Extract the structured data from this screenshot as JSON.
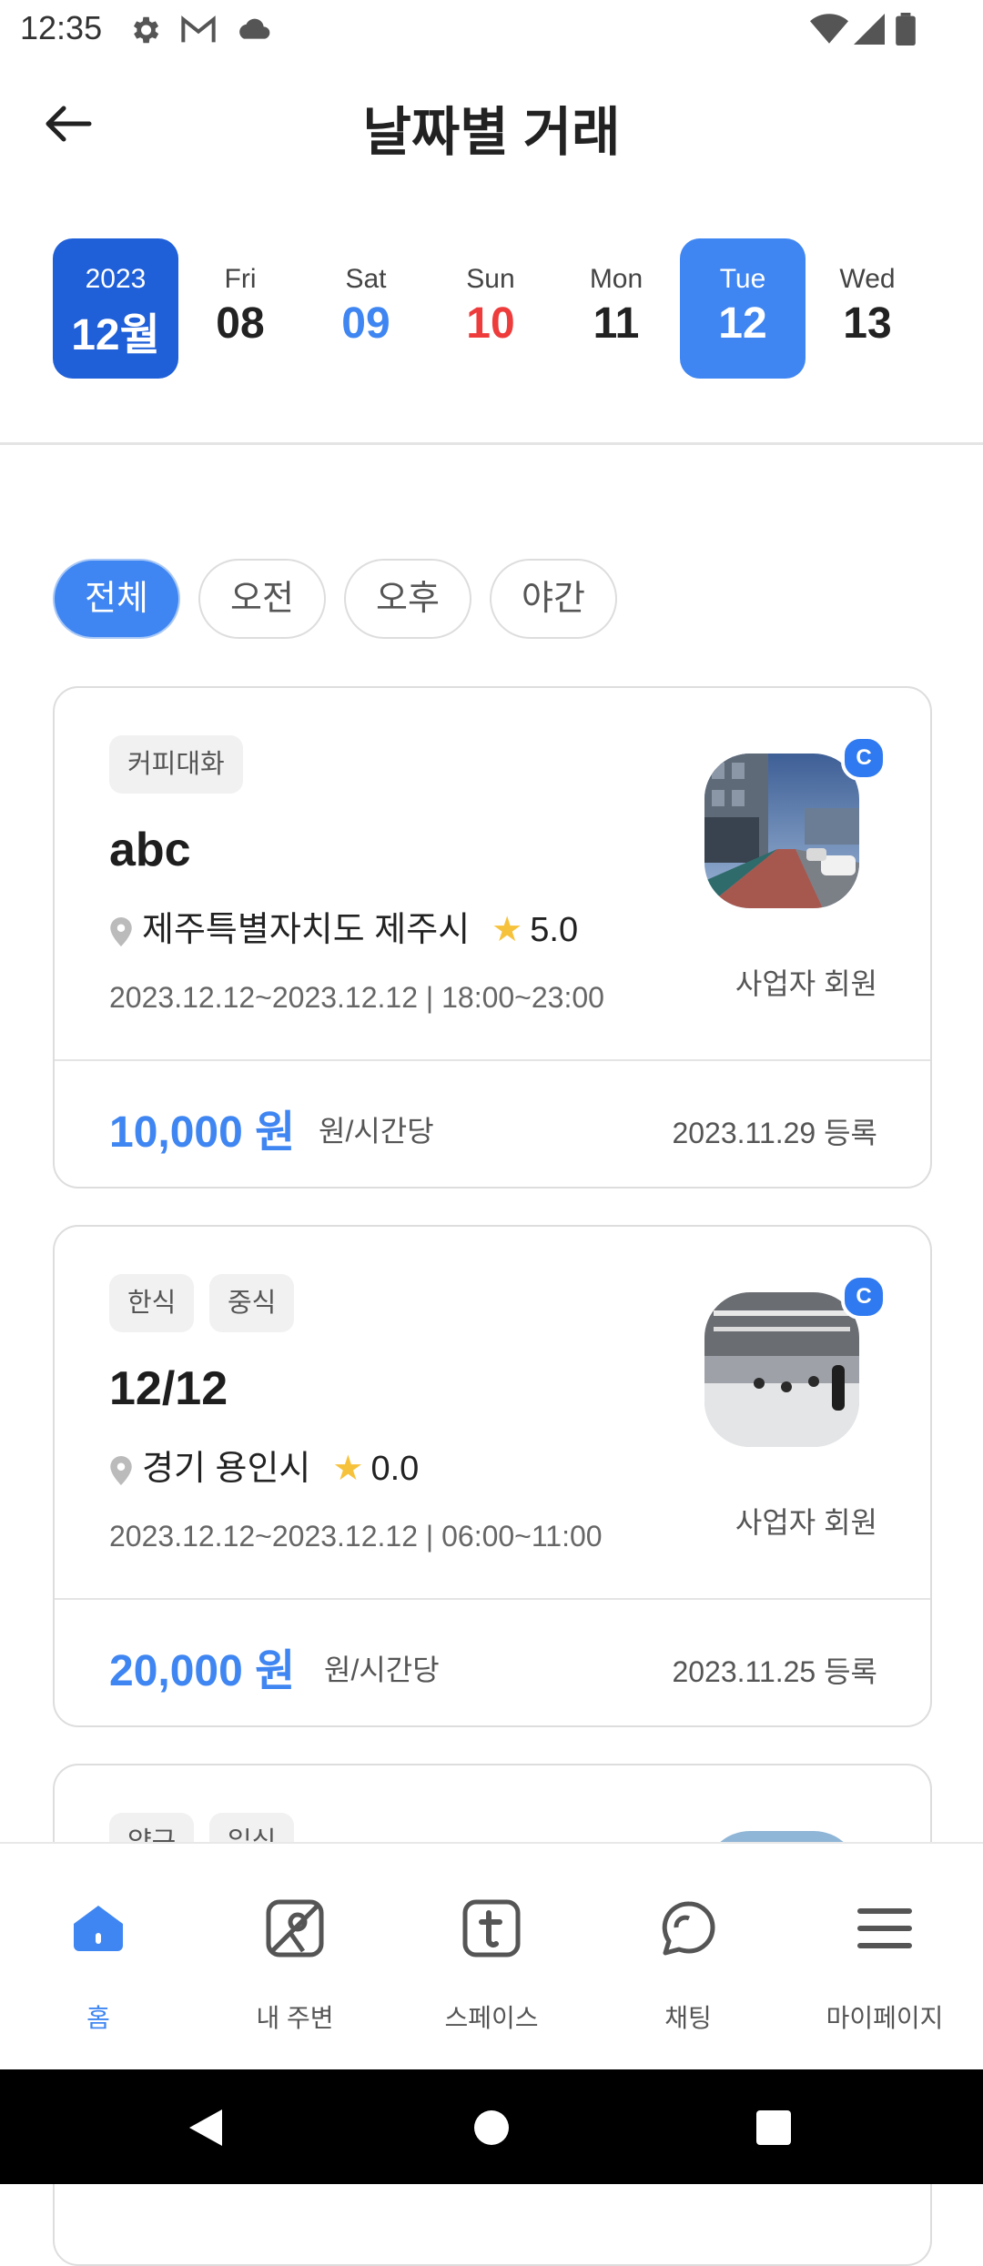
{
  "status": {
    "time": "12:35"
  },
  "header": {
    "title": "날짜별 거래"
  },
  "date_strip": {
    "month": {
      "year": "2023",
      "month": "12월"
    },
    "days": [
      {
        "dow": "Fri",
        "day": "08"
      },
      {
        "dow": "Sat",
        "day": "09"
      },
      {
        "dow": "Sun",
        "day": "10"
      },
      {
        "dow": "Mon",
        "day": "11"
      },
      {
        "dow": "Tue",
        "day": "12"
      },
      {
        "dow": "Wed",
        "day": "13"
      }
    ]
  },
  "filters": [
    "전체",
    "오전",
    "오후",
    "야간"
  ],
  "cards": [
    {
      "tags": [
        "커피대화"
      ],
      "title": "abc",
      "location": "제주특별자치도 제주시",
      "rating": "5.0",
      "period": "2023.12.12~2023.12.12 | 18:00~23:00",
      "badge": "C",
      "member": "사업자 회원",
      "price": "10,000 원",
      "unit": "원/시간당",
      "registered": "2023.11.29 등록"
    },
    {
      "tags": [
        "한식",
        "중식"
      ],
      "title": "12/12",
      "location": "경기 용인시",
      "rating": "0.0",
      "period": "2023.12.12~2023.12.12 | 06:00~11:00",
      "badge": "C",
      "member": "사업자 회원",
      "price": "20,000 원",
      "unit": "원/시간당",
      "registered": "2023.11.25 등록"
    },
    {
      "tags": [
        "양구",
        "일식"
      ]
    }
  ],
  "bottom_nav": [
    {
      "label": "홈",
      "icon": "home-icon"
    },
    {
      "label": "내 주변",
      "icon": "map-icon"
    },
    {
      "label": "스페이스",
      "icon": "space-icon"
    },
    {
      "label": "채팅",
      "icon": "chat-icon"
    },
    {
      "label": "마이페이지",
      "icon": "menu-icon"
    }
  ],
  "colors": {
    "accent": "#3f86f2",
    "month_bg": "#1f5fd8",
    "sunday": "#ee3b3b",
    "star": "#f7c23b"
  }
}
